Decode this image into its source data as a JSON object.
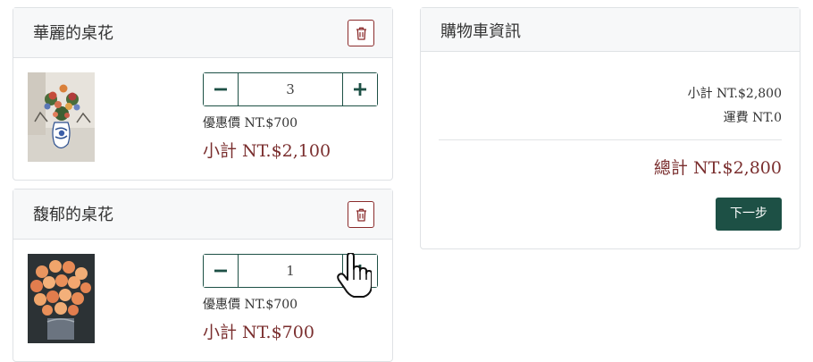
{
  "cart_items": [
    {
      "title": "華麗的桌花",
      "quantity": "3",
      "unit_price": "優惠價 NT.$700",
      "subtotal": "小計 NT.$2,100"
    },
    {
      "title": "馥郁的桌花",
      "quantity": "1",
      "unit_price": "優惠價 NT.$700",
      "subtotal": "小計 NT.$700"
    }
  ],
  "summary": {
    "title": "購物車資訊",
    "subtotal": "小計 NT.$2,800",
    "shipping": "運費 NT.0",
    "total": "總計 NT.$2,800",
    "next_label": "下一步"
  },
  "icons": {
    "delete": "trash-icon",
    "decrease": "minus-icon",
    "increase": "plus-icon",
    "cursor": "hand-pointer-icon"
  },
  "colors": {
    "primary": "#1d5045",
    "danger": "#8b2c2c",
    "price": "#7a2e2e",
    "header_bg": "#f7f8f9",
    "border": "#dfe2e5"
  }
}
